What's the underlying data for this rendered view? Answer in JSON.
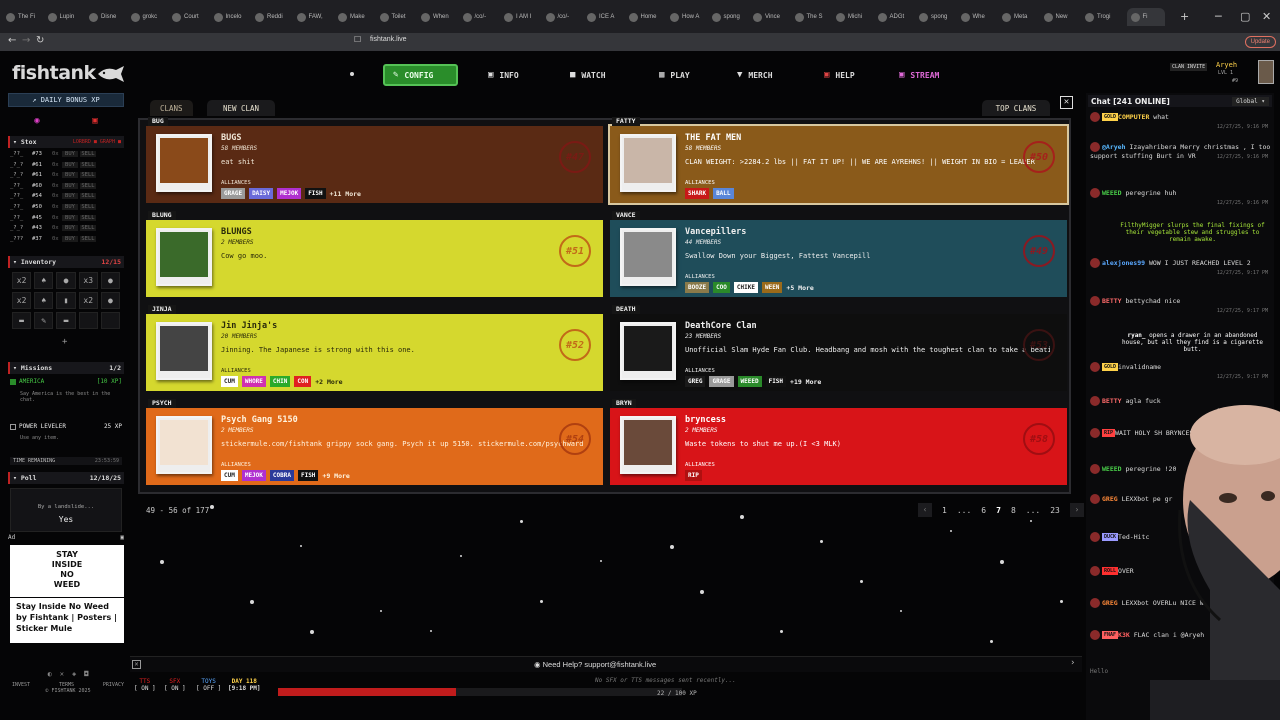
{
  "browser": {
    "tabs": [
      "The Fi",
      "Lupin",
      "Disne",
      "grokc",
      "Court",
      "Incelo",
      "Reddi",
      "FAW,",
      "Make",
      "Toilet",
      "When",
      "/co/-",
      "I AM I",
      "/co/-",
      "ICE A",
      "Home",
      "How A",
      "spong",
      "Vince",
      "The S",
      "Michi",
      "ADGt",
      "spong",
      "Whe",
      "Meta",
      "New",
      "Trogi",
      "Fi"
    ],
    "url": "fishtank.live",
    "update_label": "Update"
  },
  "colors": {
    "accent_green": "#2a8d2a",
    "accent_red": "#c11c1c",
    "stream_pink": "#e06ad8"
  },
  "logo": "fishtank",
  "nav": {
    "config": "CONFIG",
    "info": "INFO",
    "watch": "WATCH",
    "play": "PLAY",
    "merch": "MERCH",
    "help": "HELP",
    "stream": "STREAM"
  },
  "profile": {
    "clan_invite": "CLAN INVITE",
    "name": "Aryeh",
    "level": "LVL 1",
    "rank": "#9"
  },
  "sidebar": {
    "daily_bonus": "DAILY BONUS XP",
    "stox": {
      "title": "Stox",
      "tabs": "LORBRD ■ GRAPH ■",
      "rows": [
        {
          "name": "_??_",
          "rank": "#73",
          "box": "0x",
          "buy": "BUY",
          "sell": "SELL"
        },
        {
          "name": "_?_?",
          "rank": "#61",
          "box": "0x",
          "buy": "BUY",
          "sell": "SELL"
        },
        {
          "name": "_?_?",
          "rank": "#61",
          "box": "0x",
          "buy": "BUY",
          "sell": "SELL"
        },
        {
          "name": "_??_",
          "rank": "#60",
          "box": "0x",
          "buy": "BUY",
          "sell": "SELL"
        },
        {
          "name": "_??_",
          "rank": "#54",
          "box": "0x",
          "buy": "BUY",
          "sell": "SELL"
        },
        {
          "name": "_??_",
          "rank": "#50",
          "box": "0x",
          "buy": "BUY",
          "sell": "SELL"
        },
        {
          "name": "_??_",
          "rank": "#45",
          "box": "0x",
          "buy": "BUY",
          "sell": "SELL"
        },
        {
          "name": "_?_?",
          "rank": "#43",
          "box": "0x",
          "buy": "BUY",
          "sell": "SELL"
        },
        {
          "name": "_???",
          "rank": "#37",
          "box": "0x",
          "buy": "BUY",
          "sell": "SELL"
        }
      ]
    },
    "inventory": {
      "title": "Inventory",
      "count": "12/15",
      "add": "+",
      "items": [
        "x2",
        "♠",
        "●",
        "x3",
        "●",
        "x2",
        "♠",
        "▮",
        "x2",
        "●",
        "▬",
        "✎",
        "▬",
        "",
        ""
      ]
    },
    "missions": {
      "title": "Missions",
      "count": "1/2",
      "items": [
        {
          "name": "AMERICA",
          "xp": "[10 XP]",
          "desc": "Say America is the best in the chat."
        },
        {
          "name": "POWER LEVELER",
          "xp": "25 XP",
          "desc": "Use any item."
        }
      ],
      "time_label": "TIME REMAINING",
      "time_value": "23:53:59"
    },
    "poll": {
      "title": "Poll",
      "date": "12/18/25",
      "question": "By a landslide...",
      "answer": "Yes"
    },
    "ad": {
      "label": "Ad",
      "image_text": "STAY INSIDE NO WEED",
      "caption": "Stay Inside No Weed by Fishtank | Posters | Sticker Mule"
    },
    "footer": {
      "invest": "INVEST",
      "terms": "TERMS",
      "privacy": "PRIVACY",
      "copyright": "© FISHTANK 2025"
    }
  },
  "clans": {
    "tabs": {
      "clans": "CLANS",
      "new": "NEW CLAN",
      "top": "TOP CLANS"
    },
    "close": "✕",
    "alliances_label": "ALLIANCES",
    "cards": [
      {
        "tag": "BUG",
        "name": "BUGS",
        "members": "58 MEMBERS",
        "desc": "eat shit",
        "rank": "#47",
        "chips": [
          "GRAGE",
          "DAISY",
          "MEJOK",
          "FISH"
        ],
        "more": "+11 More",
        "bg": "#5a2a14",
        "fg": "#f0e6d6",
        "rank_color": "#7a1a14"
      },
      {
        "tag": "FATTY",
        "name": "THE FAT MEN",
        "members": "58 MEMBERS",
        "desc": "CLAN WEIGHT: >2284.2 lbs || FAT IT UP! || WE ARE AYREHNS! || WEIGHT IN BIO = LEADER",
        "rank": "#50",
        "chips": [
          "SHARK",
          "BALL"
        ],
        "more": "",
        "bg": "#8a5a1a",
        "fg": "#ffffff",
        "rank_color": "#a5211b"
      },
      {
        "tag": "BLUNG",
        "name": "BLUNGS",
        "members": "2 MEMBERS",
        "desc": "Cow go moo.",
        "rank": "#51",
        "chips": [],
        "more": "",
        "bg": "#d5d82e",
        "fg": "#2a2a0a",
        "rank_color": "#c26a18"
      },
      {
        "tag": "VANCE",
        "name": "Vancepillers",
        "members": "44 MEMBERS",
        "desc": "Swallow Down your Biggest, Fattest Vancepill",
        "rank": "#49",
        "chips": [
          "BOOZE",
          "COO",
          "CHIKE",
          "WEEN"
        ],
        "more": "+5 More",
        "bg": "#1f4d5a",
        "fg": "#f0f0f0",
        "rank_color": "#8a1a22"
      },
      {
        "tag": "JINJA",
        "name": "Jin Jinja's",
        "members": "20 MEMBERS",
        "desc": "Jinning. The Japanese is strong with this one.",
        "rank": "#52",
        "chips": [
          "CUM",
          "WHORE",
          "CHIN",
          "CON"
        ],
        "more": "+2 More",
        "bg": "#d5d82e",
        "fg": "#2a2a0a",
        "rank_color": "#c26a18"
      },
      {
        "tag": "DEATH",
        "name": "DeathCore Clan",
        "members": "23 MEMBERS",
        "desc": "Unofficial Slam Hyde Fan Club. Headbang and mosh with the toughest clan to take a beating.",
        "rank": "#53",
        "chips": [
          "GREG",
          "GRAGE",
          "WEEED",
          "FISH"
        ],
        "more": "+19 More",
        "bg": "#0e0e0e",
        "fg": "#f0f0f0",
        "rank_color": "#3a1212"
      },
      {
        "tag": "PSYCH",
        "name": "Psych Gang 5150",
        "members": "2 MEMBERS",
        "desc": "stickermule.com/fishtank grippy sock gang. Psych it up 5150. stickermule.com/psychward",
        "rank": "#54",
        "chips": [
          "CUM",
          "MEJOK",
          "COBRA",
          "FISH"
        ],
        "more": "+9 More",
        "bg": "#e06a1a",
        "fg": "#fff4e0",
        "rank_color": "#b04010"
      },
      {
        "tag": "BRYN",
        "name": "bryncess",
        "members": "2 MEMBERS",
        "desc": "Waste tokens to shut me up.(I <3 MLK)",
        "rank": "#58",
        "chips": [
          "RIP"
        ],
        "more": "",
        "bg": "#d81418",
        "fg": "#fff",
        "rank_color": "#a00e12"
      }
    ],
    "chip_colors": {
      "GRAGE": "#9a9a9a",
      "DAISY": "#6a6ad8",
      "MEJOK": "#b030d0",
      "FISH": "#111111",
      "SHARK": "#c81818",
      "BALL": "#5a86d8",
      "BOOZE": "#8a7a4a",
      "COO": "#2a8a2a",
      "CHIKE": "#ffffff",
      "WEEN": "#9a6a1a",
      "CUM": "#ffffff",
      "WHORE": "#d030b0",
      "CHIN": "#2aaa2a",
      "CON": "#e02020",
      "GREG": "#1a1a1a",
      "WEEED": "#2a8a2a",
      "COBRA": "#2a3a9a",
      "RIP": "#b01010"
    },
    "count": "49 - 56 of 177",
    "pages": [
      "1",
      "...",
      "6",
      "7",
      "8",
      "...",
      "23"
    ]
  },
  "bottom": {
    "help": "Need Help? support@fishtank.live",
    "tts": "TTS",
    "tts_state": "[ ON ]",
    "sfx": "SFX",
    "sfx_state": "[ ON ]",
    "toys": "TOYS",
    "toys_state": "[ OFF ]",
    "day": "DAY 118",
    "time": "[9:18 PM]",
    "no_msgs": "No SFX or TTS messages sent recently...",
    "xp": "22 / 100 XP",
    "xp_value": 0.22
  },
  "chat": {
    "title": "Chat [241 ONLINE]",
    "room": "Global",
    "messages": [
      {
        "badge": "GOLD",
        "user": "COMPUTER",
        "text": "what",
        "ts": "12/27/25, 9:16 PM",
        "color": "#ffd24a"
      },
      {
        "badge": "",
        "user": "@Aryeh",
        "text": "Izayahribera Merry christmas , I too support stuffing Burt in VR",
        "ts": "12/27/25, 9:16 PM",
        "color": "#58b8ff"
      },
      {
        "badge": "",
        "user": "WEEED",
        "text": "peregrine huh",
        "ts": "12/27/25, 9:16 PM",
        "color": "#4ad04a"
      },
      {
        "badge": "",
        "user": "",
        "text": "FilthyMigger slurps the final fixings of their vegetable stew and struggles to remain awake.",
        "ts": "",
        "color": "#a8e83a"
      },
      {
        "badge": "",
        "user": "alexjones99",
        "text": "WOW I JUST REACHED LEVEL 2",
        "ts": "12/27/25, 9:17 PM",
        "color": "#5aa8ff"
      },
      {
        "badge": "",
        "user": "BETTY",
        "text": "bettychad nice",
        "ts": "12/27/25, 9:17 PM",
        "color": "#ff6a6a"
      },
      {
        "badge": "",
        "user": "ryan_",
        "text": "opens a drawer in an abandoned house, but all they find is a cigarette butt.",
        "ts": "",
        "color": "#ffffff"
      },
      {
        "badge": "GOLD",
        "user": "",
        "text": "invalidname",
        "ts": "12/27/25, 9:17 PM",
        "color": "#ffd24a"
      },
      {
        "badge": "",
        "user": "BETTY",
        "text": "agla fuck",
        "ts": "12/27/25, 9:17 PM",
        "color": "#ff6a6a"
      },
      {
        "badge": "RIP",
        "user": "",
        "text": "WAIT HOLY SH BRYNCESS A GIRL",
        "ts": "12/27/25, 9:17 PM",
        "color": "#ff4040"
      },
      {
        "badge": "",
        "user": "WEEED",
        "text": "peregrine !20",
        "ts": "12/27/25, 9:17 PM",
        "color": "#4ad04a"
      },
      {
        "badge": "",
        "user": "GREG",
        "text": "LEXXbot pe gr",
        "ts": "12/27/25, 9:17 PM",
        "color": "#ff8a3a"
      },
      {
        "badge": "DUCK",
        "user": "",
        "text": "Ted-Hitc",
        "ts": "12/27/25, 9:17 PM",
        "color": "#ffffff"
      },
      {
        "badge": "ROLL",
        "user": "",
        "text": "OVER",
        "ts": "12/27/25, 9:17 PM",
        "color": "#ff3030"
      },
      {
        "badge": "",
        "user": "GREG",
        "text": "LEXXbot OVERLu NICE W",
        "ts": "12/27/25, 9:17 PM",
        "color": "#ff8a3a"
      },
      {
        "badge": "FNAF",
        "user": "K3K",
        "text": "FLAC clan i @Aryeh",
        "ts": "12/27/25, 9:17 PM",
        "color": "#ff6060"
      }
    ],
    "input_placeholder": "Hello"
  }
}
